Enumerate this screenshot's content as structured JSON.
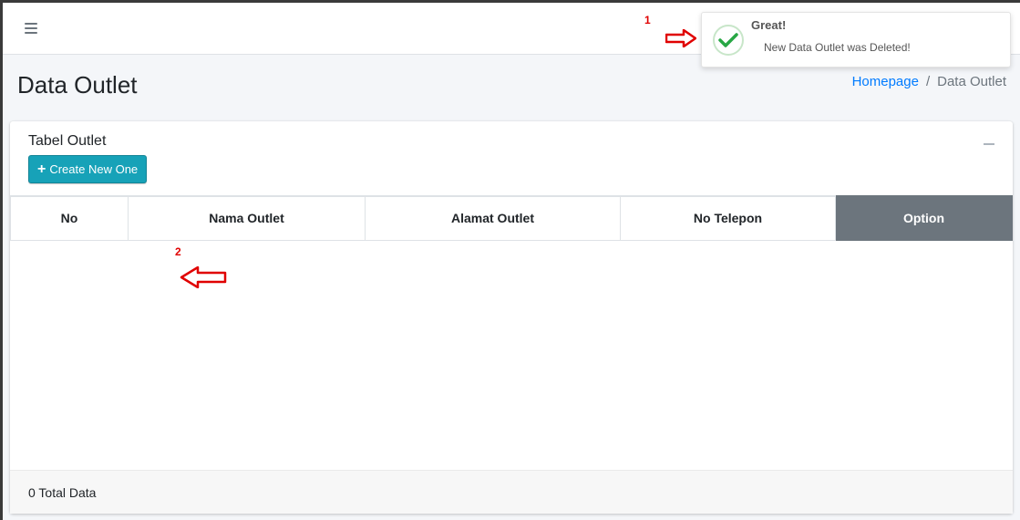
{
  "header": {
    "menu_icon": "hamburger-icon"
  },
  "page": {
    "title": "Data Outlet"
  },
  "breadcrumb": {
    "home": "Homepage",
    "separator": "/",
    "current": "Data Outlet"
  },
  "card": {
    "title": "Tabel Outlet",
    "create_button_label": "Create New One",
    "collapse_icon": "minus-icon"
  },
  "table": {
    "columns": [
      "No",
      "Nama Outlet",
      "Alamat Outlet",
      "No Telepon",
      "Option"
    ],
    "rows": []
  },
  "footer": {
    "total_text": "0 Total Data"
  },
  "toast": {
    "title": "Great!",
    "message": "New Data Outlet was Deleted!",
    "icon": "check-circle-icon",
    "accent": "#28a745"
  },
  "annotations": [
    {
      "label": "1",
      "arrow": "right-arrow-icon"
    },
    {
      "label": "2",
      "arrow": "left-arrow-icon"
    }
  ],
  "colors": {
    "primary_link": "#007bff",
    "create_button": "#17a2b8",
    "option_header": "#6c757d",
    "annotation": "#e00000"
  }
}
